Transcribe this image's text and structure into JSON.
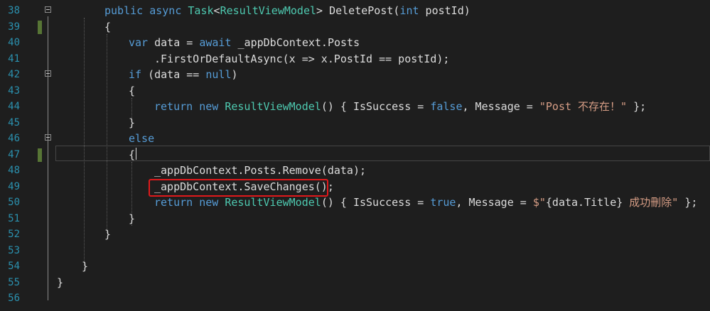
{
  "editor": {
    "lines": [
      {
        "n": "38",
        "parts": [
          [
            "kw",
            "public async "
          ],
          [
            "ty",
            "Task"
          ],
          [
            "",
            "<"
          ],
          [
            "ty",
            "ResultViewModel"
          ],
          [
            "",
            "> DeletePost("
          ],
          [
            "kw",
            "int"
          ],
          [
            "",
            " postId)"
          ]
        ]
      },
      {
        "n": "39",
        "parts": [
          [
            "",
            "{"
          ]
        ]
      },
      {
        "n": "40",
        "parts": [
          [
            "kw",
            "var"
          ],
          [
            "",
            " data = "
          ],
          [
            "kw",
            "await"
          ],
          [
            "",
            " _appDbContext.Posts"
          ]
        ]
      },
      {
        "n": "41",
        "parts": [
          [
            "",
            ".FirstOrDefaultAsync(x => x.PostId == postId);"
          ]
        ]
      },
      {
        "n": "42",
        "parts": [
          [
            "kw",
            "if"
          ],
          [
            "",
            " (data == "
          ],
          [
            "kw",
            "null"
          ],
          [
            "",
            ")"
          ]
        ]
      },
      {
        "n": "43",
        "parts": [
          [
            "",
            "{"
          ]
        ]
      },
      {
        "n": "44",
        "parts": [
          [
            "kw",
            "return new "
          ],
          [
            "ty",
            "ResultViewModel"
          ],
          [
            "",
            "() { IsSuccess = "
          ],
          [
            "kw",
            "false"
          ],
          [
            "",
            ", Message = "
          ],
          [
            "str",
            "\"Post 不存在！\""
          ],
          [
            "",
            " };"
          ]
        ]
      },
      {
        "n": "45",
        "parts": [
          [
            "",
            "}"
          ]
        ]
      },
      {
        "n": "46",
        "parts": [
          [
            "kw",
            "else"
          ]
        ]
      },
      {
        "n": "47",
        "parts": [
          [
            "",
            "{"
          ]
        ]
      },
      {
        "n": "48",
        "parts": [
          [
            "",
            "_appDbContext.Posts.Remove(data);"
          ]
        ]
      },
      {
        "n": "49",
        "parts": [
          [
            "",
            "_appDbContext.SaveChanges();"
          ]
        ]
      },
      {
        "n": "50",
        "parts": [
          [
            "kw",
            "return new "
          ],
          [
            "ty",
            "ResultViewModel"
          ],
          [
            "",
            "() { IsSuccess = "
          ],
          [
            "kw",
            "true"
          ],
          [
            "",
            ", Message = "
          ],
          [
            "str",
            "$\""
          ],
          [
            "",
            "{data.Title}"
          ],
          [
            "str",
            " 成功刪除\""
          ],
          [
            "",
            " };"
          ]
        ]
      },
      {
        "n": "51",
        "parts": [
          [
            "",
            "}"
          ]
        ]
      },
      {
        "n": "52",
        "parts": [
          [
            "",
            "}"
          ]
        ]
      },
      {
        "n": "53",
        "parts": []
      },
      {
        "n": "54",
        "parts": [
          [
            "",
            "}"
          ]
        ]
      },
      {
        "n": "55",
        "parts": [
          [
            "",
            "}"
          ]
        ]
      },
      {
        "n": "56",
        "parts": []
      }
    ]
  }
}
